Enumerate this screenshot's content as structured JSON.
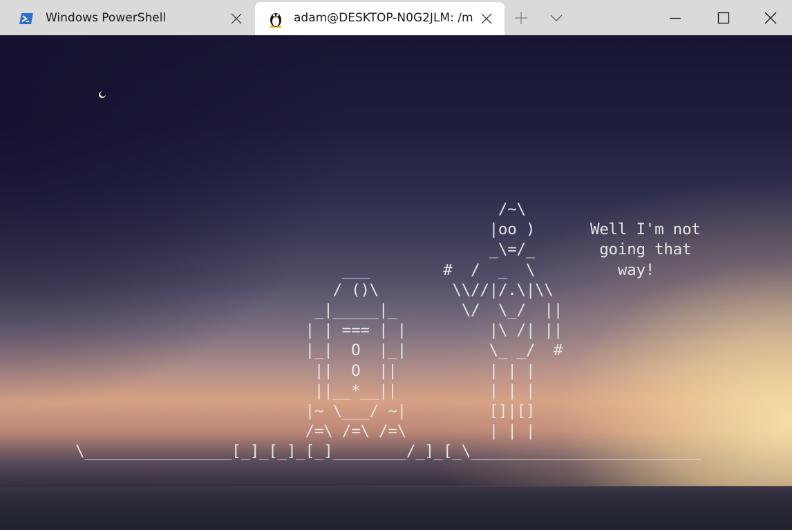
{
  "tabs": [
    {
      "label": "Windows PowerShell",
      "icon": "powershell-icon",
      "active": false
    },
    {
      "label": "adam@DESKTOP-N0G2JLM: /m",
      "icon": "linux-penguin-icon",
      "active": true
    }
  ],
  "titlebar": {
    "new_tab_icon": "plus-icon",
    "dropdown_icon": "chevron-down-icon",
    "window_controls": [
      "minimize-icon",
      "maximize-icon",
      "close-icon"
    ]
  },
  "terminal": {
    "ascii_art": "                                              /~\\\n                                             |oo )      Well I'm not\n                                             _\\=/_       going that\n                             ___        #  /  _  \\         way!\n                            / ()\\        \\\\//|/.\\|\\\\\n                          _|_____|_       \\/  \\_/  ||\n                         | | === | |         |\\ /| ||\n                         |_|  O  |_|         \\_ _/  #\n                          ||  O  ||          | | |\n                          ||__*__||          | | |\n                         |~ \\___/ ~|         []|[]\n                         /=\\ /=\\ /=\\         | | |\n\\________________[_]_[_]_[_]________/_]_[_\\_________________________",
    "text_color": "#e4e4e4",
    "background": "sunset-sky-over-sea"
  },
  "colors": {
    "titlebar_bg": "#dadada",
    "active_tab_bg": "#ffffff",
    "powershell_blue": "#2f6fd1"
  }
}
